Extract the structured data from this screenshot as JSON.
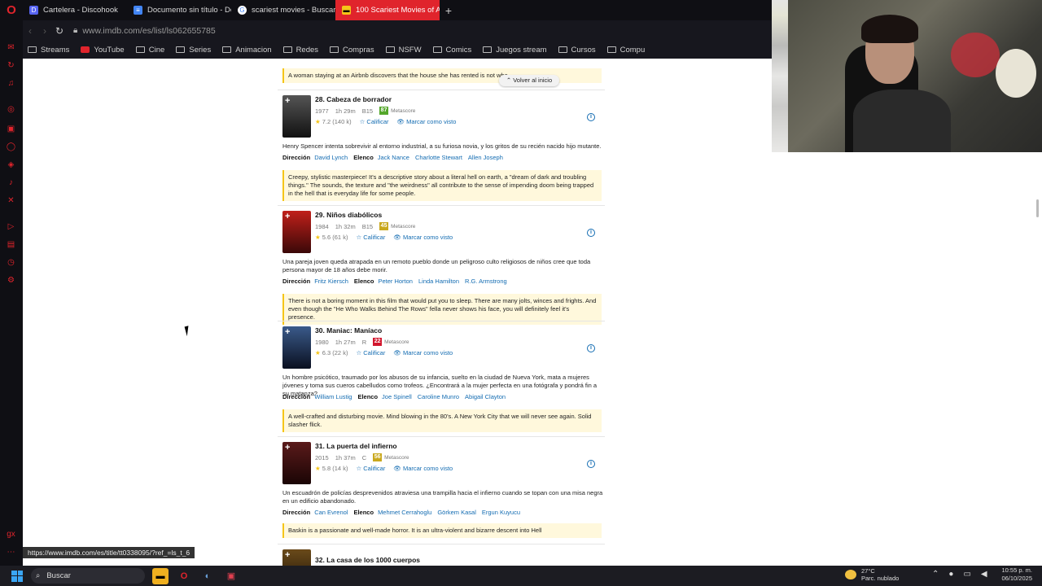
{
  "browser": {
    "tabs": [
      {
        "label": "Cartelera - Discohook",
        "color": "#5865f2",
        "glyph": "D"
      },
      {
        "label": "Documento sin título - Do",
        "color": "#4285f4",
        "glyph": "≡"
      },
      {
        "label": "scariest movies - Buscar",
        "color": "#ffffff",
        "glyph": "G"
      },
      {
        "label": "100 Scariest Movies of Al",
        "color": "#f5c518",
        "glyph": "▬"
      }
    ],
    "url": "www.imdb.com/es/list/ls062655785",
    "bookmarks": [
      "Streams",
      "YouTube",
      "Cine",
      "Series",
      "Animacion",
      "Redes",
      "Compras",
      "NSFW",
      "Comics",
      "Juegos stream",
      "Cursos",
      "Compu"
    ],
    "status_url": "https://www.imdb.com/es/title/tt0338095/?ref_=ls_t_6"
  },
  "back_to_top": "Volver al inicio",
  "top_note": "A woman staying at an Airbnb discovers that the house she has rented is not wha",
  "common": {
    "metascore": "Metascore",
    "rate": "Calificar",
    "mark_seen": "Marcar como visto",
    "direction": "Dirección",
    "cast": "Elenco"
  },
  "movies": [
    {
      "title": "28. Cabeza de borrador",
      "year": "1977",
      "duration": "1h 29m",
      "rating_class": "B15",
      "metascore": "87",
      "ms_color": "#54a72a",
      "rating": "7.2",
      "votes": "(140 k)",
      "description": "Henry Spencer intenta sobrevivir al entorno industrial, a su furiosa novia, y los gritos de su recién nacido hijo mutante.",
      "director": "David Lynch",
      "cast": [
        "Jack Nance",
        "Charlotte Stewart",
        "Allen Joseph"
      ],
      "note": "Creepy, stylistic masterpiece! It's a descriptive story about a literal hell on earth, a \"dream of dark and troubling things.\" The sounds, the texture and \"the weirdness\" all contribute to the sense of impending doom being trapped in the hell that is everyday life for some people.",
      "poster_color": "#2a2a2a"
    },
    {
      "title": "29. Niños diabólicos",
      "year": "1984",
      "duration": "1h 32m",
      "rating_class": "B15",
      "metascore": "45",
      "ms_color": "#c9a81d",
      "rating": "5.6",
      "votes": "(61 k)",
      "description": "Una pareja joven queda atrapada en un remoto pueblo donde un peligroso culto religiosos de niños cree que toda persona mayor de 18 años debe morir.",
      "director": "Fritz Kiersch",
      "cast": [
        "Peter Horton",
        "Linda Hamilton",
        "R.G. Armstrong"
      ],
      "note": "There is not a boring moment in this film that would put you to sleep. There are many jolts, winces and frights. And even though the \"He Who Walks Behind The Rows\" fella never shows his face, you will definitely feel it's presence.",
      "poster_color": "#8a1a14"
    },
    {
      "title": "30. Maniac: Maníaco",
      "year": "1980",
      "duration": "1h 27m",
      "rating_class": "R",
      "metascore": "22",
      "ms_color": "#d2172e",
      "rating": "6.3",
      "votes": "(22 k)",
      "description": "Un hombre psicótico, traumado por los abusos de su infancia, suelto en la ciudad de Nueva York, mata a mujeres jóvenes y toma sus cueros cabelludos como trofeos. ¿Encontrará a la mujer perfecta en una fotógrafa y pondrá fin a su matanza?",
      "director": "William Lustig",
      "cast": [
        "Joe Spinell",
        "Caroline Munro",
        "Abigail Clayton"
      ],
      "note": "A well-crafted and disturbing movie. Mind blowing in the 80's. A New York City that we will never see again. Solid slasher flick.",
      "poster_color": "#1c2a44"
    },
    {
      "title": "31. La puerta del infierno",
      "year": "2015",
      "duration": "1h 37m",
      "rating_class": "C",
      "metascore": "56",
      "ms_color": "#c9a81d",
      "rating": "5.8",
      "votes": "(14 k)",
      "description": "Un escuadrón de policías desprevenidos atraviesa una trampilla hacia el infierno cuando se topan con una misa negra en un edificio abandonado.",
      "director": "Can Evrenol",
      "cast": [
        "Mehmet Cerrahoglu",
        "Görkem Kasal",
        "Ergun Kuyucu"
      ],
      "note": "Baskin is a passionate and well-made horror. It is an ultra-violent and bizarre descent into Hell",
      "poster_color": "#3a1010"
    }
  ],
  "next_title": "32. La casa de los 1000 cuerpos",
  "taskbar": {
    "search": "Buscar",
    "temperature": "27°C",
    "weather": "Parc. nublado",
    "time": "10:55 p. m.",
    "date": "06/10/2025"
  }
}
